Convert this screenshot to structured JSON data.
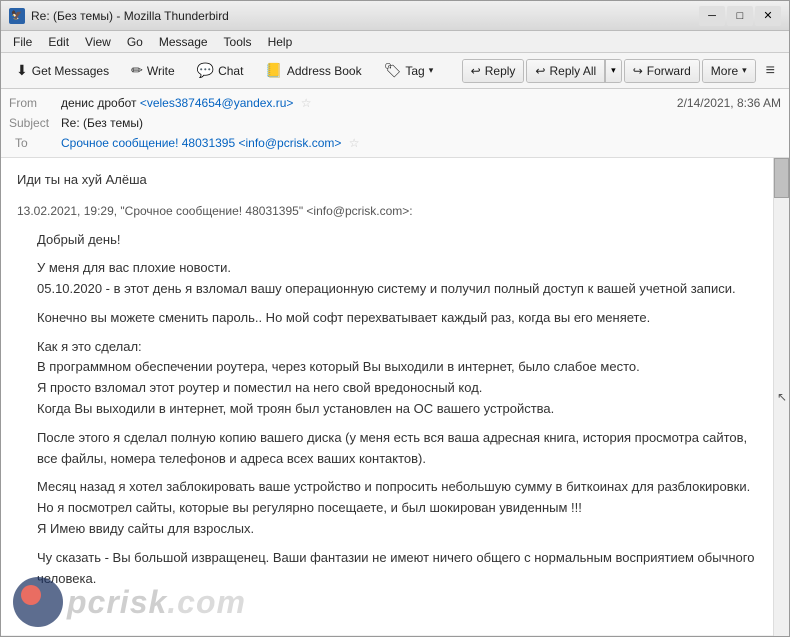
{
  "window": {
    "title": "Re: (Без темы) - Mozilla Thunderbird",
    "icon": "TB"
  },
  "menu": {
    "items": [
      "File",
      "Edit",
      "View",
      "Go",
      "Message",
      "Tools",
      "Help"
    ]
  },
  "toolbar": {
    "get_messages": "Get Messages",
    "write": "Write",
    "chat": "Chat",
    "address_book": "Address Book",
    "tag": "Tag",
    "hamburger": "≡"
  },
  "actions": {
    "reply": "Reply",
    "reply_all": "Reply All",
    "forward": "Forward",
    "more": "More"
  },
  "email": {
    "from_label": "From",
    "from_name": "денис дробот",
    "from_email": "<veles3874654@yandex.ru>",
    "subject_label": "Subject",
    "subject": "Re: (Без темы)",
    "to_label": "To",
    "to_name": "Срочное сообщение! 48031395",
    "to_email": "<info@pcrisk.com>",
    "date": "2/14/2021, 8:36 AM",
    "intro_line": "Иди ты на хуй Алёша",
    "quote_line": "13.02.2021, 19:29, \"Срочное сообщение! 48031395\" <info@pcrisk.com>:",
    "body_paragraphs": [
      "Добрый день!",
      "У меня для вас плохие новости.\n05.10.2020 - в этот день я взломал вашу операционную систему и получил полный доступ к вашей учетной записи.",
      "Конечно вы можете сменить пароль.. Но мой софт перехватывает каждый раз, когда вы его меняете.",
      "Как я это сделал:\nВ программном обеспечении роутера, через который Вы выходили в интернет, было слабое место.\nЯ просто взломал этот роутер и поместил на него свой вредоносный код.\nКогда Вы выходили в интернет, мой троян был установлен на ОС вашего устройства.",
      "После этого я сделал полную копию вашего диска (у меня есть вся ваша адресная книга, история просмотра сайтов, все файлы, номера телефонов и адреса всех ваших контактов).",
      "Месяц назад я хотел заблокировать ваше устройство и попросить небольшую сумму в биткоинах для разблокировки.\nНо я посмотрел сайты, которые вы регулярно посещаете, и был шокирован увиденным !!!\nЯ Имею ввиду сайты для взрослых.",
      "Чу сказать - Вы большой извращенец. Ваши фантазии не имеют ничего общего с нормальным восприятием обычного человека."
    ]
  },
  "watermark": {
    "text": "pcrisk",
    "domain": ".com"
  }
}
